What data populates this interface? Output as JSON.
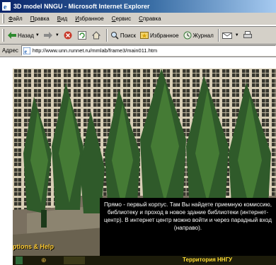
{
  "window": {
    "title": "3D model NNGU - Microsoft Internet Explorer",
    "icon": "ie-icon"
  },
  "menu": {
    "items": [
      "Файл",
      "Правка",
      "Вид",
      "Избранное",
      "Сервис",
      "Справка"
    ]
  },
  "toolbar": {
    "back_label": "Назад",
    "search_label": "Поиск",
    "favorites_label": "Избранное",
    "history_label": "Журнал"
  },
  "address": {
    "label": "Адрес",
    "url": "http://www.unn.runnet.ru/mmlab/frame3/main011.htm"
  },
  "scene": {
    "caption": "Прямо - первый корпус. Там Вы найдете приемную комиссию, библиотеку и проход в новое здание библиотеки (интернет-центр). В интернет центр можно войти и через парадный вход (направо).",
    "options_help": "ptions & Help",
    "territory": "Территория ННГУ"
  },
  "colors": {
    "titlebar": "#0a246a",
    "chrome": "#d4d0c8",
    "caption_bg": "#000000",
    "caption_text": "#ffffff",
    "territory": "#ffdd33"
  }
}
